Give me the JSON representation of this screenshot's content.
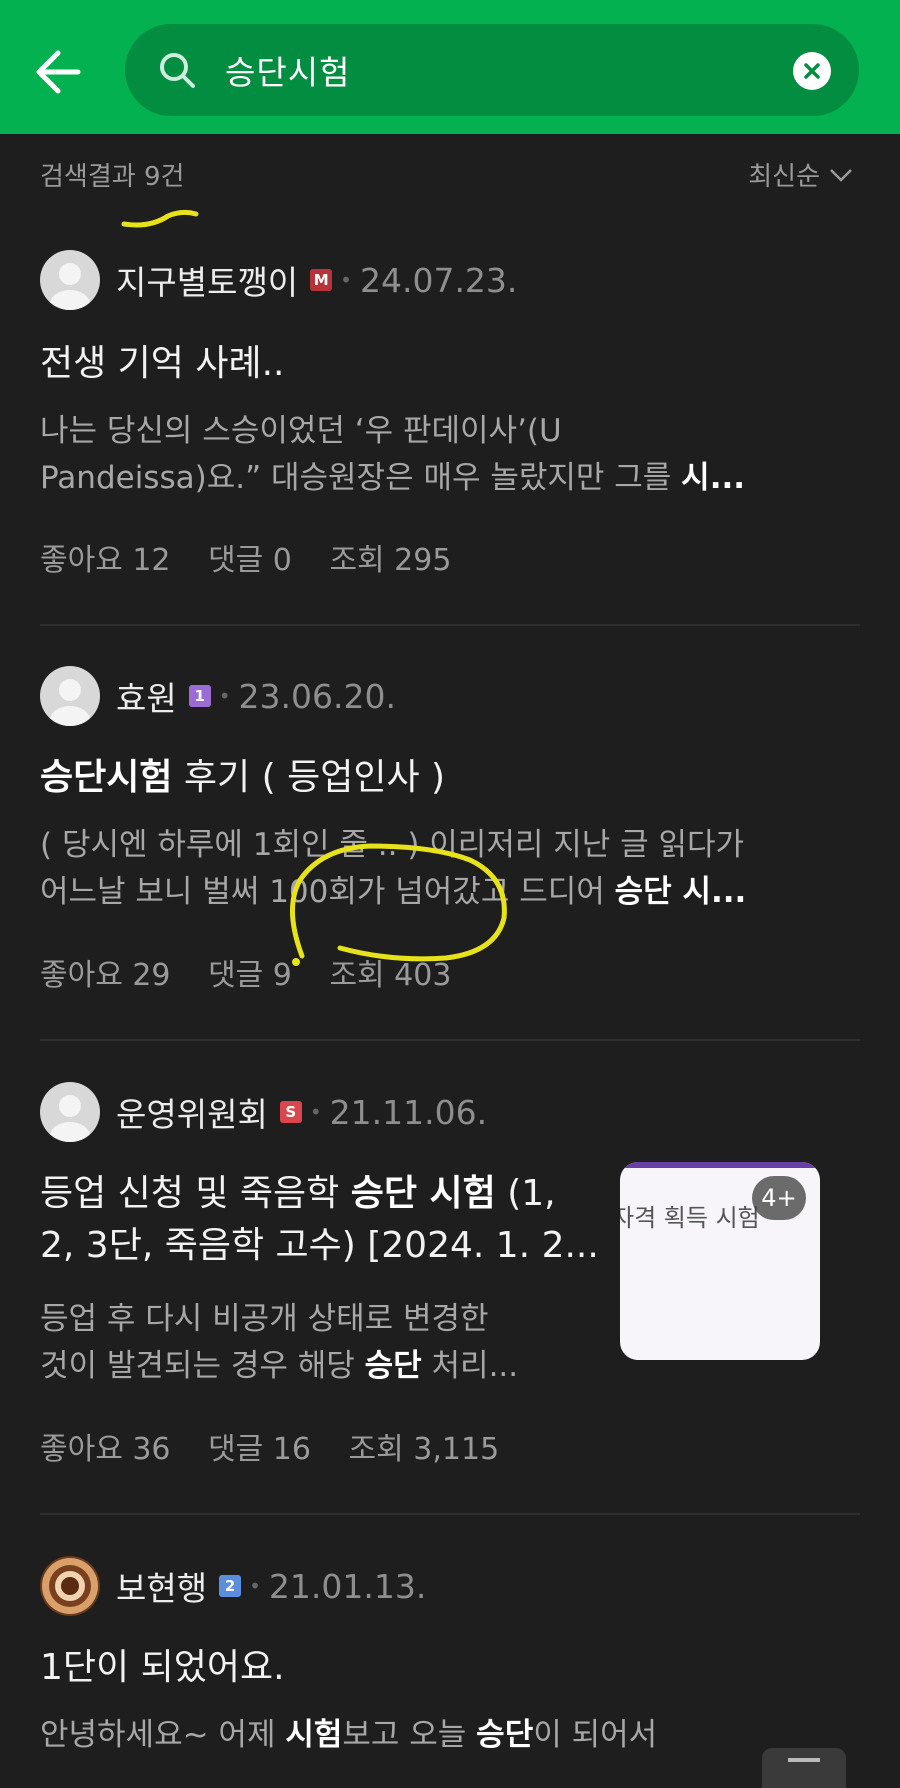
{
  "search": {
    "query": "승단시험"
  },
  "results": {
    "count_label": "검색결과 9건",
    "sort_label": "최신순"
  },
  "posts": [
    {
      "author": "지구별토깽이",
      "badge": "M",
      "date": "24.07.23.",
      "title": "전생 기억 사례..",
      "snippet_l1": "나는 당신의 스승이었던 ‘우 판데이사’(U",
      "snippet_l2a": "Pandeissa)요.” 대승원장은 매우 놀랐지만 그를 ",
      "snippet_l2b": "시...",
      "likes": "좋아요 12",
      "comments": "댓글 0",
      "views": "조회 295"
    },
    {
      "author": "효원",
      "badge": "1",
      "date": "23.06.20.",
      "title_bold": "승단시험",
      "title_rest": " 후기 ( 등업인사 )",
      "snippet_l1": "( 당시엔 하루에 1회인 줄 .. ) 이리저리 지난 글 읽다가",
      "snippet_l2a": "어느날 보니 벌써 100회가 넘어갔고 드디어 ",
      "snippet_l2b": "승단 시...",
      "likes": "좋아요 29",
      "comments": "댓글 9",
      "views": "조회 403"
    },
    {
      "author": "운영위원회",
      "badge": "S",
      "date": "21.11.06.",
      "title_l1a": "등업 신청 및 죽음학 ",
      "title_l1b": "승단 시험",
      "title_l1c": " (1,",
      "title_l2": "2, 3단, 죽음학 고수) [2024. 1. 2...",
      "snippet_l1": "등업 후 다시 비공개 상태로 변경한",
      "snippet_l2a": "것이 발견되는 경우 해당 ",
      "snippet_l2b": "승단",
      "snippet_l2c": " 처리...",
      "likes": "좋아요 36",
      "comments": "댓글 16",
      "views": "조회 3,115",
      "thumb_text": "자격 획득 시험",
      "thumb_count": "4+"
    },
    {
      "author": "보현행",
      "badge": "2",
      "date": "21.01.13.",
      "title": "1단이 되었어요.",
      "snippet_a": "안녕하세요~ 어제 ",
      "snippet_b": "시험",
      "snippet_c": "보고 오늘 ",
      "snippet_d": "승단",
      "snippet_e": "이 되어서"
    }
  ],
  "colors": {
    "header": "#03b151",
    "search_box": "#038d41",
    "background": "#1e1e1e",
    "annotation": "#e8e21a"
  }
}
